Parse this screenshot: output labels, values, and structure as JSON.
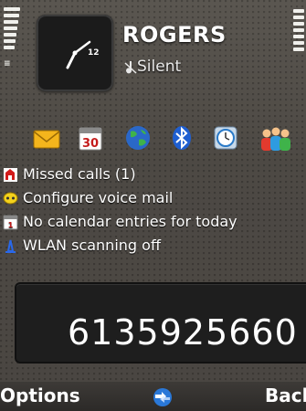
{
  "status": {
    "operator": "ROGERS",
    "profile": "Silent"
  },
  "shortcuts": [
    {
      "icon": "messaging-icon"
    },
    {
      "icon": "calendar-icon",
      "label": "30"
    },
    {
      "icon": "web-globe-icon"
    },
    {
      "icon": "bluetooth-icon"
    },
    {
      "icon": "clock-icon"
    },
    {
      "icon": "contacts-icon"
    }
  ],
  "notifications": [
    {
      "icon": "missed-call-icon",
      "text": "Missed calls (1)"
    },
    {
      "icon": "voicemail-icon",
      "text": "Configure voice mail"
    },
    {
      "icon": "calendar-small-icon",
      "text": "No calendar entries for today"
    },
    {
      "icon": "wlan-icon",
      "text": "WLAN scanning off"
    }
  ],
  "dialer": {
    "number": "6135925660"
  },
  "softkeys": {
    "left": "Options",
    "right": "Back",
    "middle_icon": "call-transfer-icon"
  },
  "clock": {
    "hour_mark": "12"
  },
  "colors": {
    "background": "#4d4944",
    "text": "#ffffff",
    "display_bg": "#1e1e1e"
  }
}
